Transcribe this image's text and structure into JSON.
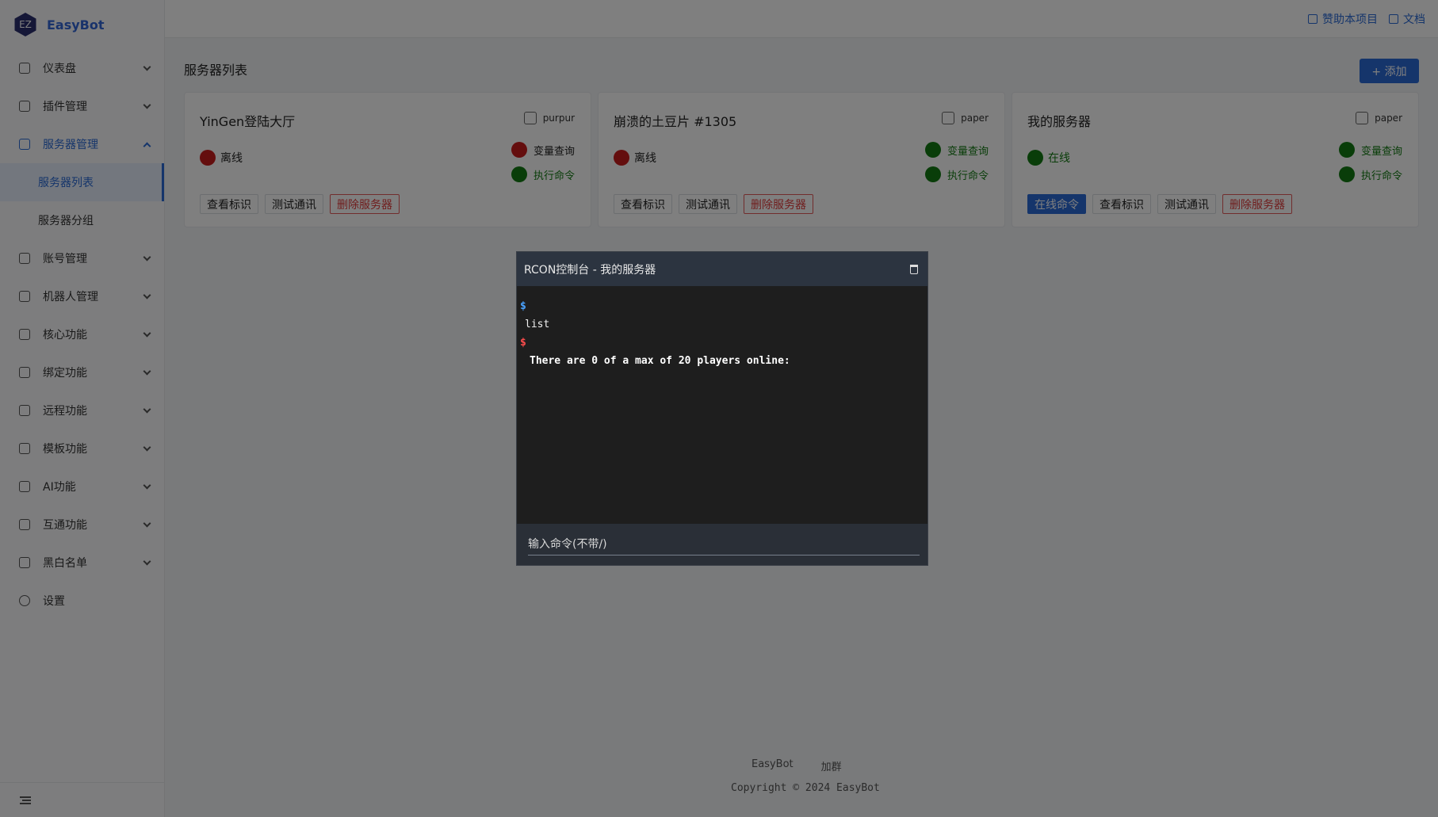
{
  "brand": {
    "logo_text": "EZ",
    "name": "EasyBot"
  },
  "sidebar": {
    "items": [
      {
        "label": "仪表盘",
        "icon": "dashboard-icon"
      },
      {
        "label": "插件管理",
        "icon": "plugin-icon"
      },
      {
        "label": "服务器管理",
        "icon": "server-icon",
        "expanded": true,
        "children": [
          {
            "label": "服务器列表",
            "active": true
          },
          {
            "label": "服务器分组"
          }
        ]
      },
      {
        "label": "账号管理",
        "icon": "account-icon"
      },
      {
        "label": "机器人管理",
        "icon": "robot-icon"
      },
      {
        "label": "核心功能",
        "icon": "core-icon"
      },
      {
        "label": "绑定功能",
        "icon": "bind-icon"
      },
      {
        "label": "远程功能",
        "icon": "remote-icon"
      },
      {
        "label": "模板功能",
        "icon": "template-icon"
      },
      {
        "label": "AI功能",
        "icon": "ai-icon"
      },
      {
        "label": "互通功能",
        "icon": "interop-icon"
      },
      {
        "label": "黑白名单",
        "icon": "list-icon"
      },
      {
        "label": "设置",
        "icon": "settings-icon"
      }
    ]
  },
  "header": {
    "sponsor": "赞助本项目",
    "docs": "文档"
  },
  "page": {
    "title": "服务器列表",
    "add_label": "+ 添加"
  },
  "cards": [
    {
      "title": "YinGen登陆大厅",
      "type": "purpur",
      "status": "离线",
      "status_color": "#c81c1c",
      "feat1": "变量查询",
      "feat1_color": "#c81c1c",
      "feat2": "执行命令",
      "feat2_color": "#127a12",
      "btn_view": "查看标识",
      "btn_test": "测试通讯",
      "btn_delete": "删除服务器"
    },
    {
      "title": "崩溃的土豆片 #1305",
      "type": "paper",
      "status": "离线",
      "status_color": "#c81c1c",
      "feat1": "变量查询",
      "feat1_color": "#127a12",
      "feat2": "执行命令",
      "feat2_color": "#127a12",
      "btn_view": "查看标识",
      "btn_test": "测试通讯",
      "btn_delete": "删除服务器"
    },
    {
      "title": "我的服务器",
      "type": "paper",
      "status": "在线",
      "status_color": "#127a12",
      "feat1": "变量查询",
      "feat1_color": "#127a12",
      "feat2": "执行命令",
      "feat2_color": "#127a12",
      "btn_online": "在线命令",
      "btn_view": "查看标识",
      "btn_test": "测试通讯",
      "btn_delete": "删除服务器"
    }
  ],
  "footer": {
    "link1": "EasyBot",
    "link2": "加群",
    "copyright": "Copyright © 2024 EasyBot"
  },
  "modal": {
    "title": "RCON控制台 - 我的服务器",
    "lines": [
      {
        "kind": "prompt",
        "text": "$",
        "color": "#4aa3ff"
      },
      {
        "kind": "cmd",
        "text": "list"
      },
      {
        "kind": "prompt",
        "text": "$",
        "color": "#ff4d4d"
      },
      {
        "kind": "out",
        "text": "There are 0 of a max of 20 players online:"
      }
    ],
    "input_placeholder": "输入命令(不带/)"
  },
  "colors": {
    "accent": "#2b6ad6",
    "danger": "#e03a3a",
    "online": "#127a12",
    "offline": "#c81c1c"
  }
}
